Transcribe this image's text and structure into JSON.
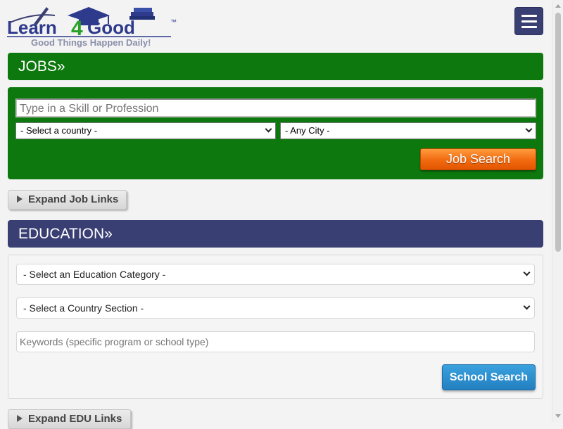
{
  "header": {
    "logo_text_left": "Learn",
    "logo_text_num": "4",
    "logo_text_right": "Good",
    "logo_tm": "™",
    "tagline": "Good Things Happen Daily!",
    "menu_icon": "hamburger-menu-icon"
  },
  "jobs": {
    "title": "JOBS»",
    "skill_placeholder": "Type in a Skill or Profession",
    "country_select": "- Select a country -",
    "city_select": "- Any City -",
    "search_label": "Job Search",
    "expand_label": "Expand Job Links"
  },
  "education": {
    "title": "EDUCATION»",
    "category_select": "- Select an Education Category -",
    "country_select": "- Select a Country Section -",
    "keywords_placeholder": "Keywords (specific program or school type)",
    "search_label": "School Search",
    "expand_label": "Expand EDU Links"
  },
  "colors": {
    "jobs_green": "#0d780d",
    "edu_navy": "#3a3f73",
    "job_search_orange": "#f26a10",
    "school_search_blue": "#2a8fcf"
  }
}
